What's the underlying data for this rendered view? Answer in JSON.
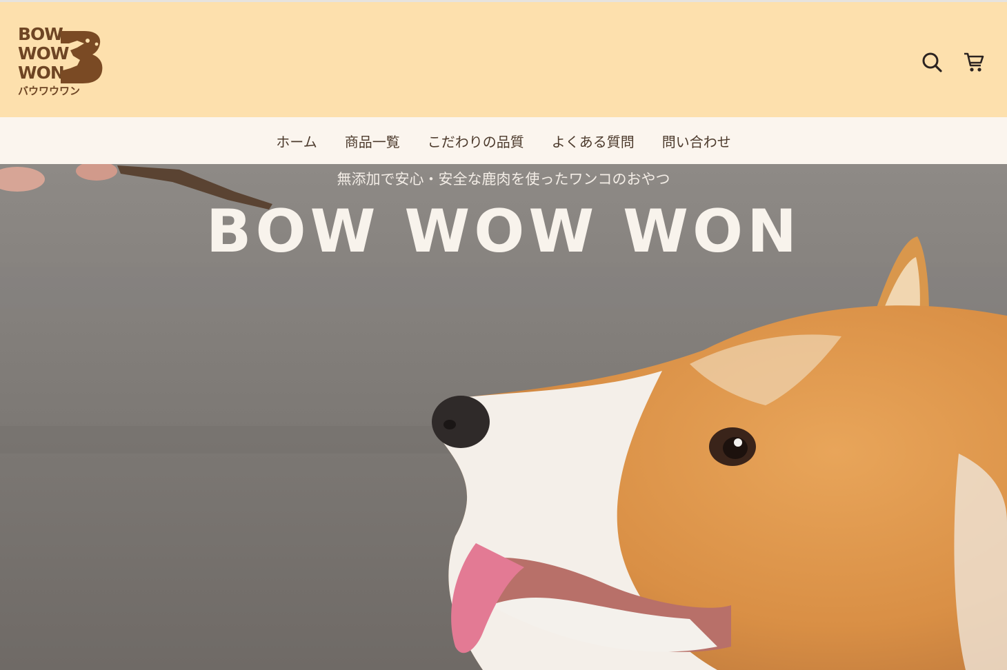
{
  "header": {
    "logo": {
      "line1": "BOW",
      "line2": "WOW",
      "line3": "WON",
      "kana": "バウワウワン",
      "mark": "B"
    },
    "icons": {
      "search": "search-icon",
      "cart": "cart-icon"
    }
  },
  "nav": {
    "items": [
      {
        "label": "ホーム"
      },
      {
        "label": "商品一覧"
      },
      {
        "label": "こだわりの品質"
      },
      {
        "label": "よくある質問"
      },
      {
        "label": "問い合わせ"
      }
    ]
  },
  "hero": {
    "subtitle": "無添加で安心・安全な鹿肉を使ったワンコのおやつ",
    "title": "BOW WOW WON"
  },
  "colors": {
    "header_bg": "#fde0ad",
    "nav_bg": "#fbf5ee",
    "brand_brown": "#6e4524",
    "nav_text": "#4c3a2c"
  }
}
